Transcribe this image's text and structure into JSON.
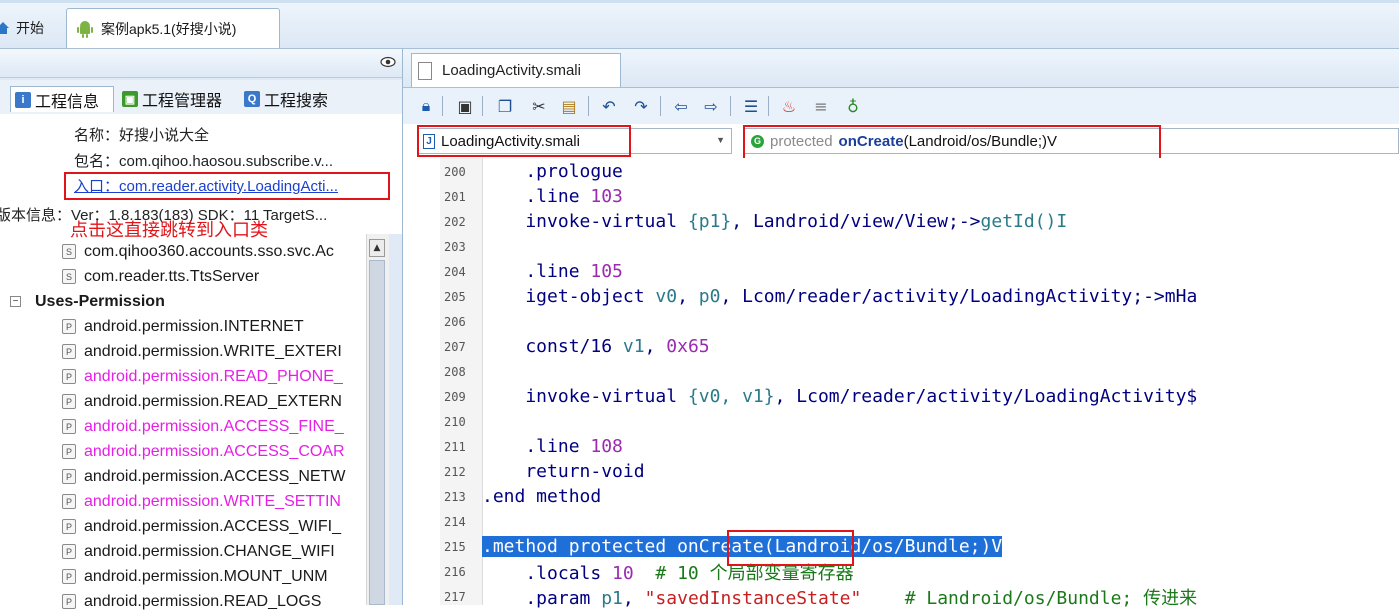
{
  "top_tabs": [
    {
      "label": "开始",
      "icon": "home-icon"
    },
    {
      "label": "案例apk5.1(好搜小说)",
      "icon": "android-icon"
    }
  ],
  "left_tabs": [
    {
      "label": "工程信息",
      "icon": "info-icon"
    },
    {
      "label": "工程管理器",
      "icon": "android-icon"
    },
    {
      "label": "工程搜索",
      "icon": "search-icon"
    }
  ],
  "project_info": {
    "name": "名称：好搜小说大全",
    "package": "包名：com.qihoo.haosou.subscribe.v...",
    "entry": "入口：com.reader.activity.LoadingActi...",
    "version": "版本信息：Ver：1.8.183(183) SDK：11 TargetS..."
  },
  "annotation": "点击这直接跳转到入口类",
  "tree_rows": [
    {
      "badge": "S",
      "label": "com.qihoo360.accounts.sso.svc.Ac",
      "pink": false
    },
    {
      "badge": "S",
      "label": "com.reader.tts.TtsServer",
      "pink": false
    },
    {
      "badge": "",
      "label": "Uses-Permission",
      "pink": false,
      "group": true
    },
    {
      "badge": "P",
      "label": "android.permission.INTERNET",
      "pink": false
    },
    {
      "badge": "P",
      "label": "android.permission.WRITE_EXTERI",
      "pink": false
    },
    {
      "badge": "P",
      "label": "android.permission.READ_PHONE_",
      "pink": true
    },
    {
      "badge": "P",
      "label": "android.permission.READ_EXTERN",
      "pink": false
    },
    {
      "badge": "P",
      "label": "android.permission.ACCESS_FINE_",
      "pink": true
    },
    {
      "badge": "P",
      "label": "android.permission.ACCESS_COAR",
      "pink": true
    },
    {
      "badge": "P",
      "label": "android.permission.ACCESS_NETW",
      "pink": false
    },
    {
      "badge": "P",
      "label": "android.permission.WRITE_SETTIN",
      "pink": true
    },
    {
      "badge": "P",
      "label": "android.permission.ACCESS_WIFI_",
      "pink": false
    },
    {
      "badge": "P",
      "label": "android.permission.CHANGE_WIFI",
      "pink": false
    },
    {
      "badge": "P",
      "label": "android.permission.MOUNT_UNM",
      "pink": false
    },
    {
      "badge": "P",
      "label": "android.permission.READ_LOGS",
      "pink": false
    }
  ],
  "file_tab": "LoadingActivity.smali",
  "file_combo": "LoadingActivity.smali",
  "method_combo": {
    "visibility": "protected",
    "name": "onCreate",
    "signature": "(Landroid/os/Bundle;)V"
  },
  "code_lines": [
    {
      "n": "200",
      "parts": [
        [
          "kw",
          "    .prologue"
        ]
      ]
    },
    {
      "n": "201",
      "parts": [
        [
          "kw",
          "    .line "
        ],
        [
          "num",
          "103"
        ]
      ]
    },
    {
      "n": "202",
      "parts": [
        [
          "kw",
          "    invoke-virtual "
        ],
        [
          "reg",
          "{p1}"
        ],
        [
          "kw",
          ", Landroid/view/View;->"
        ],
        [
          "reg",
          "getId()I"
        ]
      ]
    },
    {
      "n": "203",
      "parts": []
    },
    {
      "n": "204",
      "parts": [
        [
          "kw",
          "    .line "
        ],
        [
          "num",
          "105"
        ]
      ]
    },
    {
      "n": "205",
      "parts": [
        [
          "kw",
          "    iget-object "
        ],
        [
          "reg",
          "v0"
        ],
        [
          "kw",
          ", "
        ],
        [
          "reg",
          "p0"
        ],
        [
          "kw",
          ", Lcom/reader/activity/LoadingActivity;->mHa"
        ]
      ]
    },
    {
      "n": "206",
      "parts": []
    },
    {
      "n": "207",
      "parts": [
        [
          "kw",
          "    const/16 "
        ],
        [
          "reg",
          "v1"
        ],
        [
          "kw",
          ", "
        ],
        [
          "num",
          "0x65"
        ]
      ]
    },
    {
      "n": "208",
      "parts": []
    },
    {
      "n": "209",
      "parts": [
        [
          "kw",
          "    invoke-virtual "
        ],
        [
          "reg",
          "{v0, v1}"
        ],
        [
          "kw",
          ", Lcom/reader/activity/LoadingActivity$"
        ]
      ]
    },
    {
      "n": "210",
      "parts": []
    },
    {
      "n": "211",
      "parts": [
        [
          "kw",
          "    .line "
        ],
        [
          "num",
          "108"
        ]
      ]
    },
    {
      "n": "212",
      "parts": [
        [
          "kw",
          "    return-void"
        ]
      ]
    },
    {
      "n": "213",
      "parts": [
        [
          "kw",
          ".end method"
        ]
      ]
    },
    {
      "n": "214",
      "parts": []
    },
    {
      "n": "215",
      "selected": true,
      "parts": [
        [
          "sel",
          ".method protected onCreate(Landroid/os/Bundle;)V"
        ]
      ]
    },
    {
      "n": "216",
      "parts": [
        [
          "kw",
          "    .locals "
        ],
        [
          "num",
          "10"
        ],
        [
          "cm",
          "  # 10 个局部变量寄存器"
        ]
      ]
    },
    {
      "n": "217",
      "parts": [
        [
          "kw",
          "    .param "
        ],
        [
          "reg",
          "p1"
        ],
        [
          "kw",
          ", "
        ],
        [
          "str",
          "\"savedInstanceState\""
        ],
        [
          "cm",
          "    # Landroid/os/Bundle; 传进来"
        ]
      ]
    }
  ]
}
